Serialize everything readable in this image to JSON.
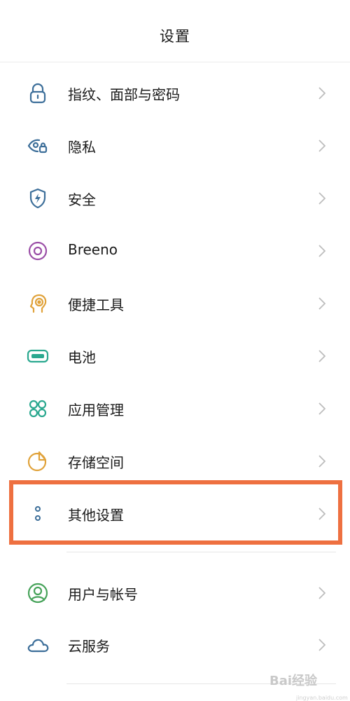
{
  "header": {
    "title": "设置"
  },
  "items": [
    {
      "id": "fingerprint",
      "label": "指纹、面部与密码",
      "icon": "lock-icon",
      "color": "#3c6e99"
    },
    {
      "id": "privacy",
      "label": "隐私",
      "icon": "privacy-eye-icon",
      "color": "#3c6e99"
    },
    {
      "id": "security",
      "label": "安全",
      "icon": "shield-bolt-icon",
      "color": "#3c6e99"
    },
    {
      "id": "breeno",
      "label": "Breeno",
      "icon": "breeno-ring-icon",
      "color": "#9b4fa7"
    },
    {
      "id": "tools",
      "label": "便捷工具",
      "icon": "head-gear-icon",
      "color": "#e0a23a"
    },
    {
      "id": "battery",
      "label": "电池",
      "icon": "battery-icon",
      "color": "#2aa88f"
    },
    {
      "id": "apps",
      "label": "应用管理",
      "icon": "app-grid-icon",
      "color": "#2aa88f"
    },
    {
      "id": "storage",
      "label": "存储空间",
      "icon": "pie-chart-icon",
      "color": "#e0a23a"
    },
    {
      "id": "other",
      "label": "其他设置",
      "icon": "dots-icon",
      "color": "#3c6e99"
    },
    {
      "id": "accounts",
      "label": "用户与帐号",
      "icon": "user-circle-icon",
      "color": "#47a35a"
    },
    {
      "id": "cloud",
      "label": "云服务",
      "icon": "cloud-icon",
      "color": "#3c6e99"
    }
  ],
  "highlighted_item": "other",
  "watermark": {
    "text": "Bai经验",
    "sub": "jingyan.baidu.com"
  }
}
